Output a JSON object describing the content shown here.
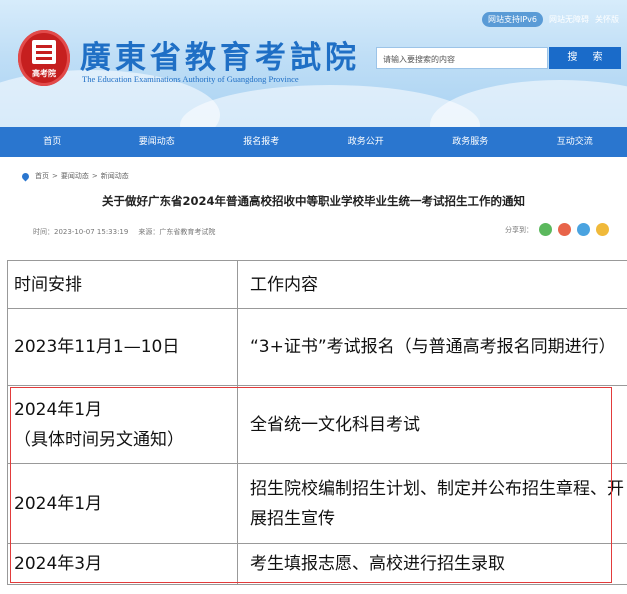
{
  "header": {
    "logo_text": "高考院",
    "site_title": "廣東省教育考試院",
    "site_subtitle": "The Education Examinations Authority of Guangdong Province",
    "top_links": [
      "网站支持IPv6",
      "网站无障碍",
      "关怀版"
    ],
    "search": {
      "placeholder": "请输入要搜索的内容",
      "button_label": "搜 索"
    }
  },
  "nav": {
    "items": [
      "首页",
      "要闻动态",
      "报名报考",
      "政务公开",
      "政务服务",
      "互动交流"
    ]
  },
  "article": {
    "breadcrumb": [
      "首页",
      "要闻动态",
      "新闻动态"
    ],
    "title": "关于做好广东省2024年普通高校招收中等职业学校毕业生统一考试招生工作的通知",
    "time": "时间：2023-10-07 15:33:19",
    "source": "来源：广东省教育考试院",
    "share_label": "分享到："
  },
  "schedule": {
    "headers": [
      "时间安排",
      "工作内容"
    ],
    "rows": [
      {
        "time": "2023年11月1—10日",
        "time_note": "",
        "content": "“3+证书”考试报名（与普通高考报名同期进行）"
      },
      {
        "time": "2024年1月",
        "time_note": "（具体时间另文通知）",
        "content": "全省统一文化科目考试"
      },
      {
        "time": "2024年1月",
        "time_note": "",
        "content": "招生院校编制招生计划、制定并公布招生章程、开展招生宣传"
      },
      {
        "time": "2024年3月",
        "time_note": "",
        "content": "考生填报志愿、高校进行招生录取"
      }
    ]
  },
  "colors": {
    "nav_bg": "#2a76cf",
    "title_blue": "#1f6fc5",
    "highlight_red": "#e23b3b",
    "seal_red": "#c61f1f"
  },
  "icons": [
    "location-pin-icon",
    "wechat-share-icon",
    "weibo-share-icon",
    "qzone-share-icon",
    "favorite-share-icon"
  ]
}
